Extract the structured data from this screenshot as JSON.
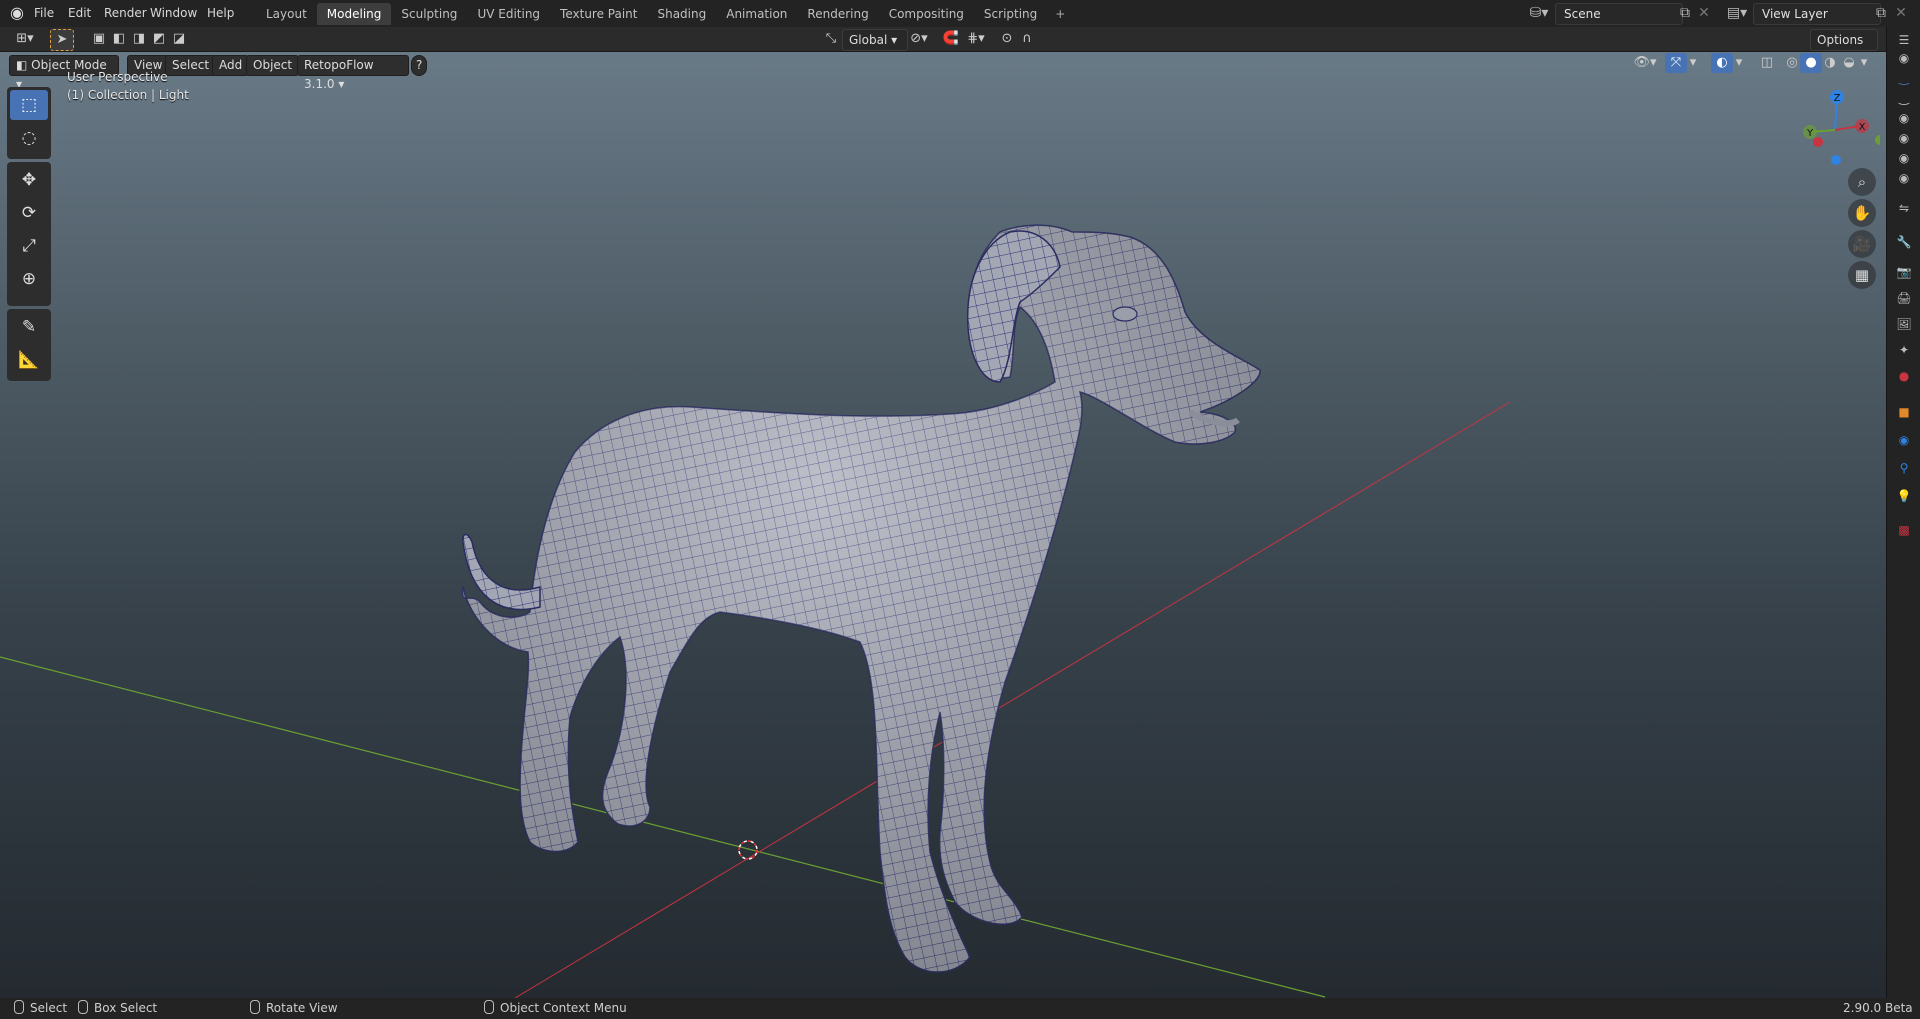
{
  "menu": [
    "File",
    "Edit",
    "Render",
    "Window",
    "Help"
  ],
  "workspaces": [
    "Layout",
    "Modeling",
    "Sculpting",
    "UV Editing",
    "Texture Paint",
    "Shading",
    "Animation",
    "Rendering",
    "Compositing",
    "Scripting"
  ],
  "active_workspace": "Modeling",
  "add_workspace": "+",
  "scene": "Scene",
  "view_layer": "View Layer",
  "transform_orientation": "Global",
  "options": "Options",
  "mode": "Object Mode",
  "viewport_menus": [
    "View",
    "Select",
    "Add",
    "Object"
  ],
  "addon": "RetopoFlow 3.1.0",
  "help_glyph": "?",
  "overlay_text": {
    "perspective": "User Perspective",
    "collection": "(1) Collection | Light"
  },
  "gizmo": {
    "x": "X",
    "y": "Y",
    "z": "Z"
  },
  "status": {
    "select": "Select",
    "box_select": "Box Select",
    "rotate": "Rotate View",
    "context": "Object Context Menu",
    "version": "2.90.0 Beta"
  },
  "colors": {
    "accent": "#4772b3",
    "x_axis": "#c8343f",
    "y_axis": "#6aa033",
    "z_axis": "#2f83e3"
  }
}
